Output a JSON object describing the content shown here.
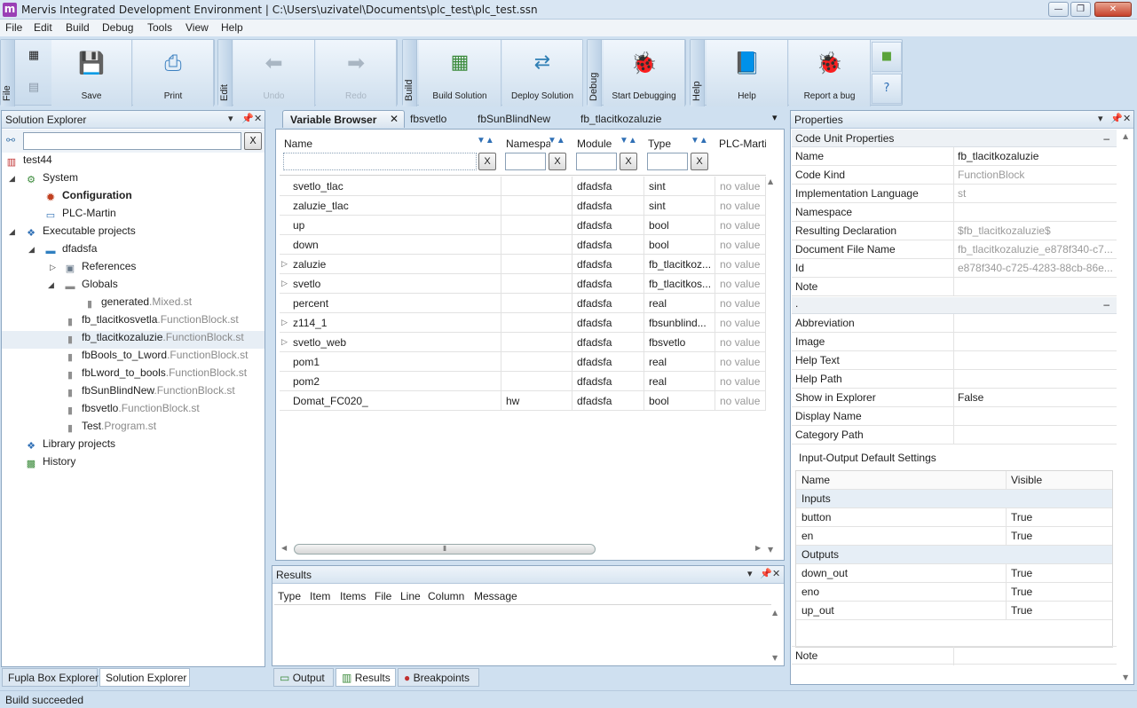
{
  "window": {
    "title": "Mervis Integrated Development Environment | C:\\Users\\uzivatel\\Documents\\plc_test\\plc_test.ssn",
    "app_icon": "m"
  },
  "menu": [
    "File",
    "Edit",
    "Build",
    "Debug",
    "Tools",
    "View",
    "Help"
  ],
  "toolbar": {
    "groups": {
      "file": "File",
      "edit": "Edit",
      "build": "Build",
      "debug": "Debug",
      "help": "Help"
    },
    "buttons": {
      "save": "Save",
      "print": "Print",
      "undo": "Undo",
      "redo": "Redo",
      "build_solution": "Build Solution",
      "deploy_solution": "Deploy Solution",
      "start_debugging": "Start Debugging",
      "help": "Help",
      "report_bug": "Report a bug"
    }
  },
  "solution_explorer": {
    "title": "Solution Explorer",
    "search_clear": "X",
    "tree": [
      {
        "label": "test44",
        "icon": "solution-icon"
      },
      {
        "label": "System",
        "icon": "system-icon"
      },
      {
        "label": "Configuration",
        "icon": "gear-icon"
      },
      {
        "label": "PLC-Martin",
        "icon": "plc-icon"
      },
      {
        "label": "Executable projects",
        "icon": "project-icon"
      },
      {
        "label": "dfadsfa",
        "icon": "folder-icon"
      },
      {
        "label": "References",
        "icon": "references-icon"
      },
      {
        "label": "Globals",
        "icon": "folder-icon"
      },
      {
        "label": "generated",
        "ext": ".Mixed.st",
        "icon": "file-icon"
      },
      {
        "label": "fb_tlacitkosvetla",
        "ext": ".FunctionBlock.st",
        "icon": "file-icon"
      },
      {
        "label": "fb_tlacitkozaluzie",
        "ext": ".FunctionBlock.st",
        "icon": "file-icon"
      },
      {
        "label": "fbBools_to_Lword",
        "ext": ".FunctionBlock.st",
        "icon": "file-icon"
      },
      {
        "label": "fbLword_to_bools",
        "ext": ".FunctionBlock.st",
        "icon": "file-icon"
      },
      {
        "label": "fbSunBlindNew",
        "ext": ".FunctionBlock.st",
        "icon": "file-icon"
      },
      {
        "label": "fbsvetlo",
        "ext": ".FunctionBlock.st",
        "icon": "file-icon"
      },
      {
        "label": "Test",
        "ext": ".Program.st",
        "icon": "file-icon"
      },
      {
        "label": "Library projects",
        "icon": "library-icon"
      },
      {
        "label": "History",
        "icon": "history-icon"
      }
    ],
    "bottom_tabs": [
      "Fupla Box Explorer",
      "Solution Explorer"
    ]
  },
  "editor": {
    "tabs": [
      "Variable Browser",
      "fbsvetlo",
      "fbSunBlindNew",
      "fb_tlacitkozaluzie"
    ],
    "columns": [
      "Name",
      "Namespace",
      "Module",
      "Type",
      "PLC-Martin"
    ],
    "filter_clear": "X",
    "rows": [
      {
        "name": "svetlo_tlac",
        "ns": "",
        "module": "dfadsfa",
        "type": "sint",
        "value": "no value",
        "expand": false
      },
      {
        "name": "zaluzie_tlac",
        "ns": "",
        "module": "dfadsfa",
        "type": "sint",
        "value": "no value",
        "expand": false
      },
      {
        "name": "up",
        "ns": "",
        "module": "dfadsfa",
        "type": "bool",
        "value": "no value",
        "expand": false
      },
      {
        "name": "down",
        "ns": "",
        "module": "dfadsfa",
        "type": "bool",
        "value": "no value",
        "expand": false
      },
      {
        "name": "zaluzie",
        "ns": "",
        "module": "dfadsfa",
        "type": "fb_tlacitkoz...",
        "value": "no value",
        "expand": true
      },
      {
        "name": "svetlo",
        "ns": "",
        "module": "dfadsfa",
        "type": "fb_tlacitkos...",
        "value": "no value",
        "expand": true
      },
      {
        "name": "percent",
        "ns": "",
        "module": "dfadsfa",
        "type": "real",
        "value": "no value",
        "expand": false
      },
      {
        "name": "z114_1",
        "ns": "",
        "module": "dfadsfa",
        "type": "fbsunblind...",
        "value": "no value",
        "expand": true
      },
      {
        "name": "svetlo_web",
        "ns": "",
        "module": "dfadsfa",
        "type": "fbsvetlo",
        "value": "no value",
        "expand": true
      },
      {
        "name": "pom1",
        "ns": "",
        "module": "dfadsfa",
        "type": "real",
        "value": "no value",
        "expand": false
      },
      {
        "name": "pom2",
        "ns": "",
        "module": "dfadsfa",
        "type": "real",
        "value": "no value",
        "expand": false
      },
      {
        "name": "Domat_FC020_",
        "ns": "hw",
        "module": "dfadsfa",
        "type": "bool",
        "value": "no value",
        "expand": false
      }
    ]
  },
  "results": {
    "title": "Results",
    "columns": [
      "Type",
      "Item",
      "Items",
      "File",
      "Line",
      "Column",
      "Message"
    ],
    "bottom_tabs": [
      "Output",
      "Results",
      "Breakpoints"
    ]
  },
  "properties": {
    "title": "Properties",
    "section1": "Code Unit Properties",
    "rows1": [
      {
        "k": "Name",
        "v": "fb_tlacitkozaluzie",
        "gray": false
      },
      {
        "k": "Code Kind",
        "v": "FunctionBlock",
        "gray": true
      },
      {
        "k": "Implementation Language",
        "v": "st",
        "gray": true
      },
      {
        "k": "Namespace",
        "v": "",
        "gray": false
      },
      {
        "k": "Resulting Declaration",
        "v": "$fb_tlacitkozaluzie$",
        "gray": true
      },
      {
        "k": "Document File Name",
        "v": "fb_tlacitkozaluzie_e878f340-c7...",
        "gray": true
      },
      {
        "k": "Id",
        "v": "e878f340-c725-4283-88cb-86e...",
        "gray": true
      },
      {
        "k": "Note",
        "v": "",
        "gray": false
      }
    ],
    "section2": ".",
    "rows2": [
      {
        "k": "Abbreviation",
        "v": ""
      },
      {
        "k": "Image",
        "v": ""
      },
      {
        "k": "Help Text",
        "v": ""
      },
      {
        "k": "Help Path",
        "v": ""
      },
      {
        "k": "Show in Explorer",
        "v": "False"
      },
      {
        "k": "Display Name",
        "v": ""
      },
      {
        "k": "Category Path",
        "v": ""
      }
    ],
    "io_title": "Input-Output Default Settings",
    "io_columns": [
      "Name",
      "Visible"
    ],
    "inputs_label": "Inputs",
    "inputs": [
      {
        "n": "button",
        "v": "True"
      },
      {
        "n": "en",
        "v": "True"
      }
    ],
    "outputs_label": "Outputs",
    "outputs": [
      {
        "n": "down_out",
        "v": "True"
      },
      {
        "n": "eno",
        "v": "True"
      },
      {
        "n": "up_out",
        "v": "True"
      }
    ],
    "note": "Note",
    "collapse": "–"
  },
  "status": "Build succeeded"
}
